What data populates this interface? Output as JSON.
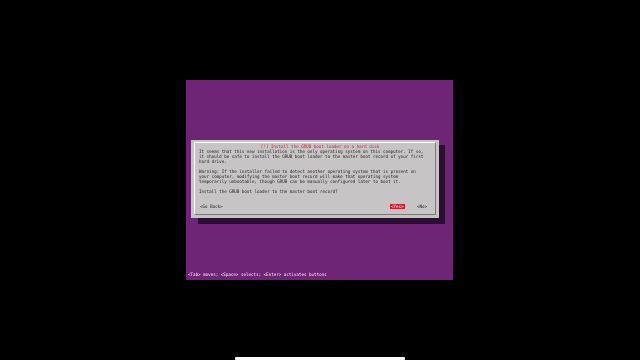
{
  "dialog": {
    "title": "[!] Install the GRUB boot loader on a hard disk",
    "paragraph1": [
      "It seems that this new installation is the only operating system on this computer. If so,",
      "it should be safe to install the GRUB boot loader to the master boot record of your first",
      "hard drive."
    ],
    "paragraph2": [
      "Warning: If the installer failed to detect another operating system that is present on",
      "your computer, modifying the master boot record will make that operating system",
      "temporarily unbootable, though GRUB can be manually configured later to boot it."
    ],
    "question": "Install the GRUB boot loader to the master boot record?",
    "buttons": {
      "back": "<Go Back>",
      "yes": "<Yes>",
      "no": "<No>"
    }
  },
  "status_line": "<Tab> moves; <Space> selects; <Enter> activates buttons",
  "colors": {
    "screen_bg": "#6e2575",
    "dialog_bg": "#c7c4c5",
    "accent_red": "#c8202c"
  }
}
